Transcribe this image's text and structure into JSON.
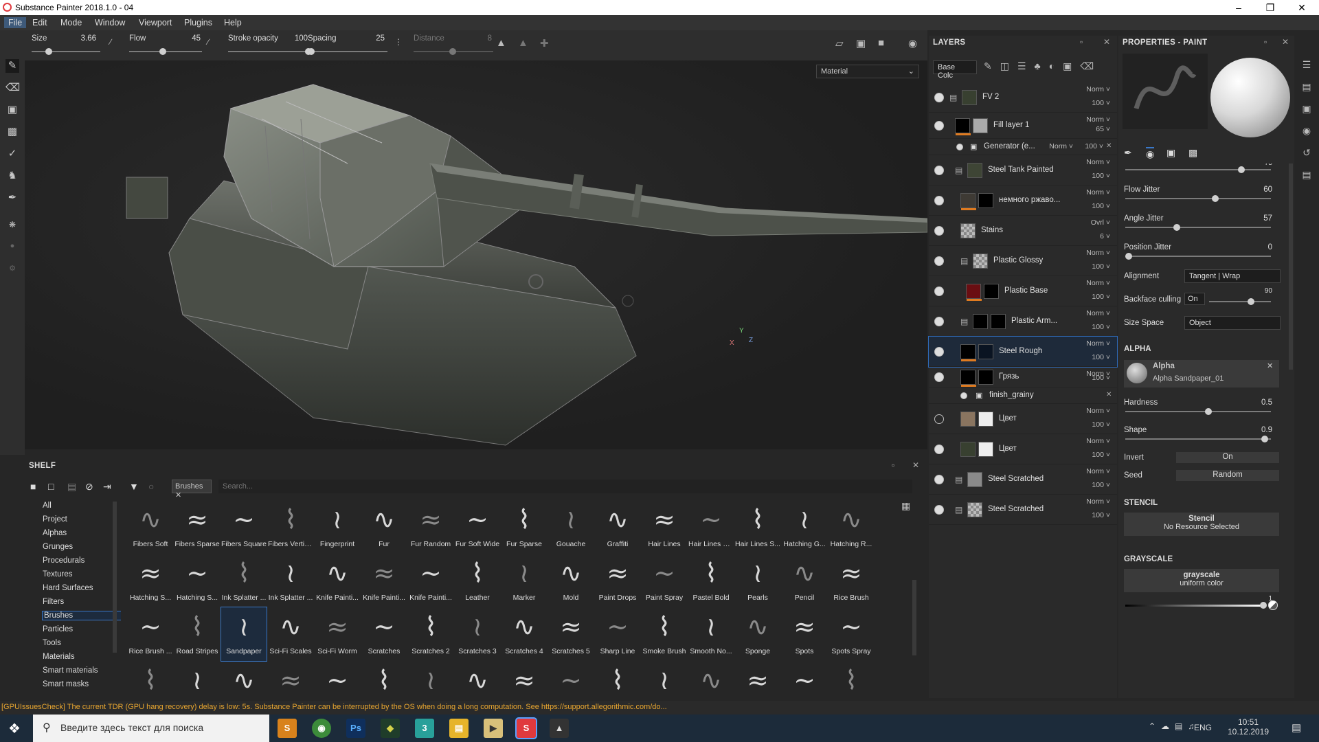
{
  "window": {
    "title": "Substance Painter 2018.1.0 - 04"
  },
  "menu": [
    "File",
    "Edit",
    "Mode",
    "Window",
    "Viewport",
    "Plugins",
    "Help"
  ],
  "toolbar": {
    "size_label": "Size",
    "size_value": "3.66",
    "flow_label": "Flow",
    "flow_value": "45",
    "opacity_label": "Stroke opacity",
    "opacity_value": "100",
    "spacing_label": "Spacing",
    "spacing_value": "25",
    "distance_label": "Distance",
    "distance_value": "8"
  },
  "viewport": {
    "material_select": "Material",
    "axis_y": "Y",
    "axis_x": "X",
    "axis_z": "Z"
  },
  "layers": {
    "title": "LAYERS",
    "channel_select": "Base Colc",
    "items": [
      {
        "name": "FV 2",
        "blend": "Norm",
        "opacity": "100"
      },
      {
        "name": "Fill layer 1",
        "blend": "Norm",
        "opacity": "65"
      },
      {
        "name": "Generator (e...",
        "blend": "Norm",
        "opacity": "100"
      },
      {
        "name": "Steel Tank Painted",
        "blend": "Norm",
        "opacity": "100"
      },
      {
        "name": "немного ржаво...",
        "blend": "Norm",
        "opacity": "100"
      },
      {
        "name": "Stains",
        "blend": "Ovrl",
        "opacity": "6"
      },
      {
        "name": "Plastic Glossy",
        "blend": "Norm",
        "opacity": "100"
      },
      {
        "name": "Plastic Base",
        "blend": "Norm",
        "opacity": "100"
      },
      {
        "name": "Plastic Arm...",
        "blend": "Norm",
        "opacity": "100"
      },
      {
        "name": "Steel Rough",
        "blend": "Norm",
        "opacity": "100"
      },
      {
        "name": "Грязь",
        "blend": "Norm",
        "opacity": "100"
      },
      {
        "name": "finish_grainy",
        "blend": "",
        "opacity": ""
      },
      {
        "name": "Цвет",
        "blend": "Norm",
        "opacity": "100"
      },
      {
        "name": "Цвет",
        "blend": "Norm",
        "opacity": "100"
      },
      {
        "name": "Steel Scratched",
        "blend": "Norm",
        "opacity": "100"
      },
      {
        "name": "Steel Scratched",
        "blend": "Norm",
        "opacity": "100"
      }
    ]
  },
  "props": {
    "title": "PROPERTIES - PAINT",
    "size_jitter_value": "75",
    "flow_jitter_label": "Flow Jitter",
    "flow_jitter_value": "60",
    "angle_jitter_label": "Angle Jitter",
    "angle_jitter_value": "57",
    "pos_jitter_label": "Position Jitter",
    "pos_jitter_value": "0",
    "alignment_label": "Alignment",
    "alignment_value": "Tangent | Wrap",
    "backface_label": "Backface culling",
    "backface_value": "On",
    "backface_num": "90",
    "size_space_label": "Size Space",
    "size_space_value": "Object",
    "alpha_head": "ALPHA",
    "alpha_name": "Alpha",
    "alpha_res": "Alpha Sandpaper_01",
    "hardness_label": "Hardness",
    "hardness_value": "0.5",
    "shape_label": "Shape",
    "shape_value": "0.9",
    "invert_label": "Invert",
    "invert_value": "On",
    "seed_label": "Seed",
    "seed_value": "Random",
    "stencil_head": "STENCIL",
    "stencil_name": "Stencil",
    "stencil_res": "No Resource Selected",
    "gray_head": "GRAYSCALE",
    "gray_name": "grayscale",
    "gray_res": "uniform color",
    "gray_value": "1"
  },
  "shelf": {
    "title": "SHELF",
    "filter_tag": "Brushes",
    "search_placeholder": "Search...",
    "categories": [
      "All",
      "Project",
      "Alphas",
      "Grunges",
      "Procedurals",
      "Textures",
      "Hard Surfaces",
      "Filters",
      "Brushes",
      "Particles",
      "Tools",
      "Materials",
      "Smart materials",
      "Smart masks"
    ],
    "selected_category": "Brushes",
    "brushes": [
      "Fibers Soft",
      "Fibers Sparse",
      "Fibers Square",
      "Fibers Vertical",
      "Fingerprint",
      "Fur",
      "Fur Random",
      "Fur Soft Wide",
      "Fur Sparse",
      "Gouache",
      "Graffiti",
      "Hair Lines",
      "Hair Lines D...",
      "Hair Lines S...",
      "Hatching G...",
      "Hatching R...",
      "Hatching S...",
      "Hatching S...",
      "Ink Splatter ...",
      "Ink Splatter ...",
      "Knife Painti...",
      "Knife Painti...",
      "Knife Painti...",
      "Leather",
      "Marker",
      "Mold",
      "Paint Drops",
      "Paint Spray",
      "Pastel Bold",
      "Pearls",
      "Pencil",
      "Rice Brush",
      "Rice Brush ...",
      "Road Stripes",
      "Sandpaper",
      "Sci-Fi Scales",
      "Sci-Fi Worm",
      "Scratches",
      "Scratches 2",
      "Scratches 3",
      "Scratches 4",
      "Scratches 5",
      "Sharp Line",
      "Smoke Brush",
      "Smooth No...",
      "Sponge",
      "Spots",
      "Spots Spray",
      "",
      "",
      "",
      "",
      "",
      "",
      "",
      "",
      "",
      "",
      "",
      "",
      "",
      "",
      "",
      ""
    ],
    "selected_brush": "Sandpaper"
  },
  "status": "[GPUIssuesCheck] The current TDR (GPU hang recovery) delay is low: 5s. Substance Painter can be interrupted by the OS when doing a long computation. See https://support.allegorithmic.com/do...",
  "taskbar": {
    "search_placeholder": "Введите здесь текст для поиска",
    "lang": "ENG",
    "time": "10:51",
    "date": "10.12.2019"
  }
}
